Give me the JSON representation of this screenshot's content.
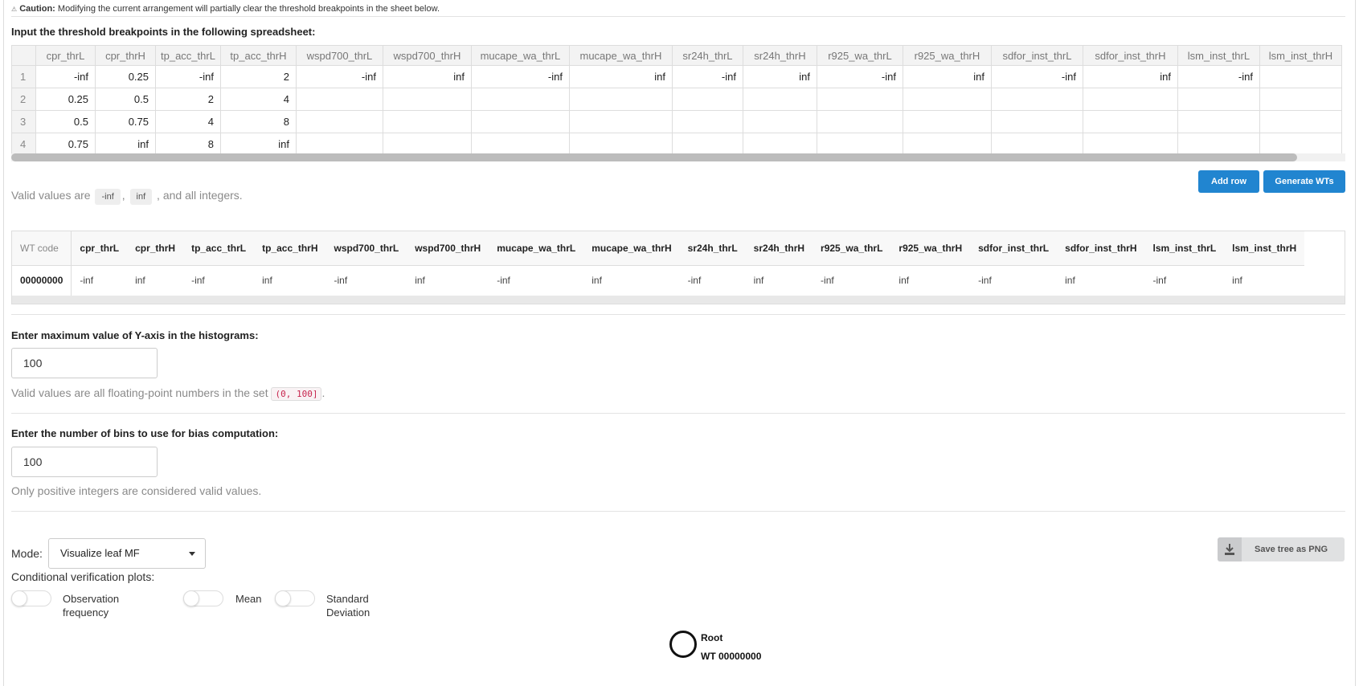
{
  "caution": {
    "title": "Caution:",
    "text": "Modifying the current arrangement will partially clear the threshold breakpoints in the sheet below."
  },
  "spreadsheet": {
    "label": "Input the threshold breakpoints in the following spreadsheet:",
    "columns": [
      "cpr_thrL",
      "cpr_thrH",
      "tp_acc_thrL",
      "tp_acc_thrH",
      "wspd700_thrL",
      "wspd700_thrH",
      "mucape_wa_thrL",
      "mucape_wa_thrH",
      "sr24h_thrL",
      "sr24h_thrH",
      "r925_wa_thrL",
      "r925_wa_thrH",
      "sdfor_inst_thrL",
      "sdfor_inst_thrH",
      "lsm_inst_thrL",
      "lsm_inst_thrH"
    ],
    "rows": [
      {
        "n": "1",
        "cells": [
          "-inf",
          "0.25",
          "-inf",
          "2",
          "-inf",
          "inf",
          "-inf",
          "inf",
          "-inf",
          "inf",
          "-inf",
          "inf",
          "-inf",
          "inf",
          "-inf",
          ""
        ]
      },
      {
        "n": "2",
        "cells": [
          "0.25",
          "0.5",
          "2",
          "4",
          "",
          "",
          "",
          "",
          "",
          "",
          "",
          "",
          "",
          "",
          "",
          ""
        ]
      },
      {
        "n": "3",
        "cells": [
          "0.5",
          "0.75",
          "4",
          "8",
          "",
          "",
          "",
          "",
          "",
          "",
          "",
          "",
          "",
          "",
          "",
          ""
        ]
      },
      {
        "n": "4",
        "cells": [
          "0.75",
          "inf",
          "8",
          "inf",
          "",
          "",
          "",
          "",
          "",
          "",
          "",
          "",
          "",
          "",
          "",
          ""
        ]
      }
    ],
    "valid_prefix": "Valid values are",
    "valid_token1": "-inf",
    "valid_sep": ",",
    "valid_token2": "inf",
    "valid_suffix": ", and all integers.",
    "add_row": "Add row",
    "generate": "Generate WTs"
  },
  "wt_table": {
    "first_header": "WT code",
    "columns": [
      "cpr_thrL",
      "cpr_thrH",
      "tp_acc_thrL",
      "tp_acc_thrH",
      "wspd700_thrL",
      "wspd700_thrH",
      "mucape_wa_thrL",
      "mucape_wa_thrH",
      "sr24h_thrL",
      "sr24h_thrH",
      "r925_wa_thrL",
      "r925_wa_thrH",
      "sdfor_inst_thrL",
      "sdfor_inst_thrH",
      "lsm_inst_thrL",
      "lsm_inst_thrH"
    ],
    "row_code": "00000000",
    "row_values": [
      "-inf",
      "inf",
      "-inf",
      "inf",
      "-inf",
      "inf",
      "-inf",
      "inf",
      "-inf",
      "inf",
      "-inf",
      "inf",
      "-inf",
      "inf",
      "-inf",
      "inf"
    ]
  },
  "yaxis": {
    "label": "Enter maximum value of Y-axis in the histograms:",
    "value": "100",
    "help_prefix": "Valid values are all floating-point numbers in the set",
    "help_code": "(0, 100]",
    "help_suffix": "."
  },
  "bins": {
    "label": "Enter the number of bins to use for bias computation:",
    "value": "100",
    "help": "Only positive integers are considered valid values."
  },
  "mode": {
    "label": "Mode:",
    "selected": "Visualize leaf MF",
    "cond_label": "Conditional verification plots:",
    "toggles": [
      {
        "line1": "Observation",
        "line2": "frequency"
      },
      {
        "line1": "Mean",
        "line2": ""
      },
      {
        "line1": "Standard",
        "line2": "Deviation"
      }
    ],
    "save": "Save tree as PNG"
  },
  "tree": {
    "root": "Root",
    "wt": "WT 00000000"
  },
  "icons": {
    "caution": "warning-icon",
    "download": "download-icon",
    "caret": "caret-down-icon"
  }
}
